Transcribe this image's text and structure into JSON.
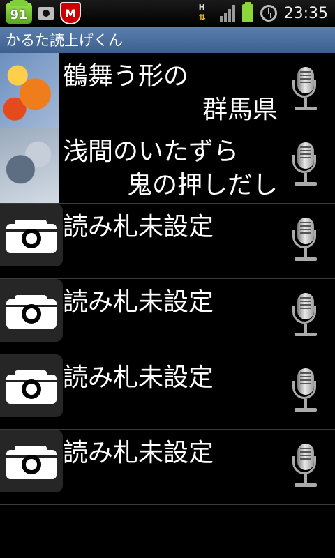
{
  "status_bar": {
    "battery_badge": "91",
    "network_type": "H",
    "time": "23:35"
  },
  "app": {
    "title": "かるた読上げくん"
  },
  "rows": [
    {
      "thumb": "card-image",
      "line1": "鶴舞う形の",
      "line2": "群馬県"
    },
    {
      "thumb": "card-image",
      "line1": "浅間のいたずら",
      "line2": "鬼の押しだし"
    },
    {
      "thumb": "camera-icon",
      "line1": "読み札未設定",
      "line2": ""
    },
    {
      "thumb": "camera-icon",
      "line1": "読み札未設定",
      "line2": ""
    },
    {
      "thumb": "camera-icon",
      "line1": "読み札未設定",
      "line2": ""
    },
    {
      "thumb": "camera-icon",
      "line1": "読み札未設定",
      "line2": ""
    }
  ]
}
